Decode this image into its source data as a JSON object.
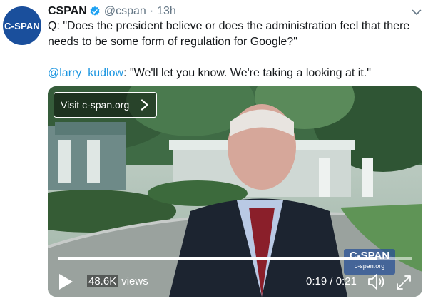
{
  "tweet": {
    "author_name": "CSPAN",
    "handle": "@cspan",
    "separator": "·",
    "time": "13h",
    "avatar_text": "C-SPAN",
    "verified_icon": "verified-badge-icon",
    "text_line1": "Q: \"Does the president believe or does the administration feel that there needs to be some form of regulation for Google?\"",
    "mention": "@larry_kudlow",
    "reply_text": ": \"We'll let you know. We're taking a looking at it.\""
  },
  "video": {
    "visit_label": "Visit c-span.org",
    "logo_main": "C-SPAN",
    "logo_sub": "c-span.org",
    "views_count": "48.6K",
    "views_label": "views",
    "time_display": "0:19 / 0:21",
    "progress_fraction": 0.9
  },
  "colors": {
    "brand_blue": "#1a4f9c",
    "mention_blue": "#1b95e0",
    "verified_blue": "#1da1f2"
  }
}
